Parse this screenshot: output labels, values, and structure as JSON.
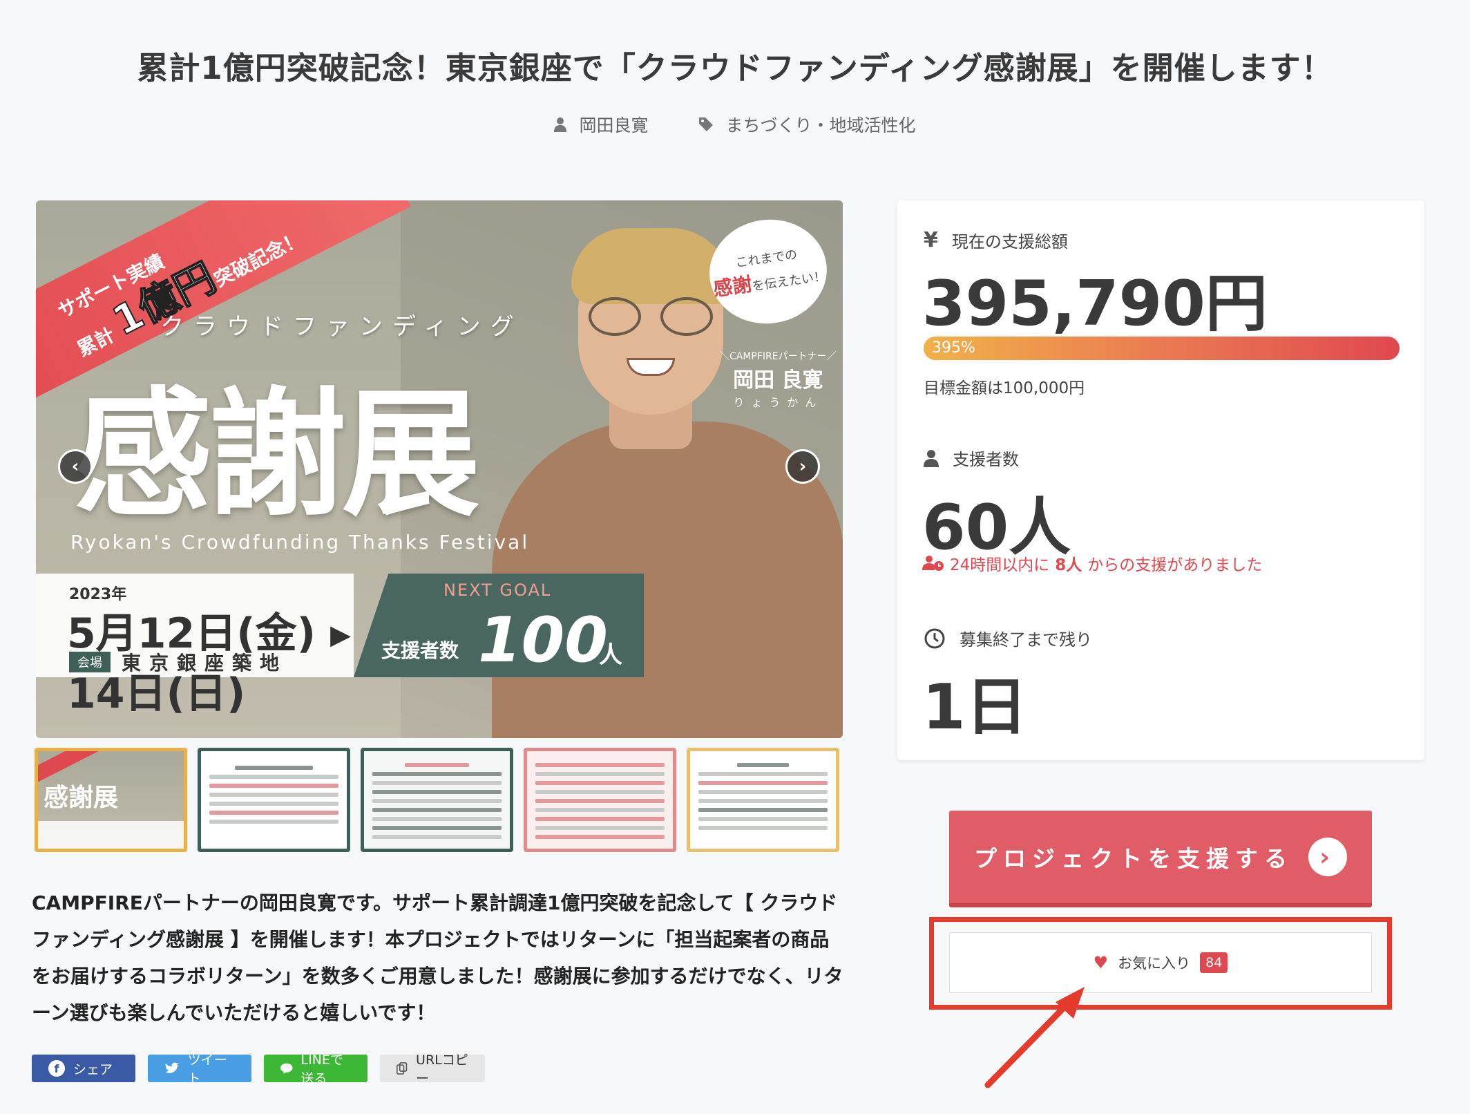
{
  "page": {
    "title": "累計1億円突破記念！東京銀座で「クラウドファンディング感謝展」を開催します！",
    "author": "岡田良寛",
    "category": "まちづくり・地域活性化"
  },
  "hero": {
    "ribbon_line1": "サポート実績",
    "ribbon_prefix": "累計",
    "ribbon_big": "1億円",
    "ribbon_line2": "突破記念！",
    "subtitle_jp": "クラウドファンディング",
    "main_jp": "感謝展",
    "main_en": "Ryokan's Crowdfunding Thanks Festival",
    "bubble_small": "これまでの",
    "bubble_accent": "感謝",
    "bubble_rest": "を伝えたい！",
    "role": "＼CAMPFIREパートナー／",
    "name": "岡田 良寛",
    "name_kana": "りょうかん",
    "year": "2023年",
    "dates": "5月12日(金) ▸ 14日(日)",
    "venue_label": "会場",
    "venue": "東京銀座築地",
    "next_goal": "NEXT GOAL",
    "goal_label": "支援者数",
    "goal_number": "100",
    "goal_unit": "人",
    "prev_glyph": "‹",
    "next_glyph": "›"
  },
  "thumbs": {
    "t1_text": "感謝展"
  },
  "description": "CAMPFIREパートナーの岡田良寛です。サポート累計調達1億円突破を記念して【 クラウドファンディング感謝展 】を開催します！本プロジェクトではリターンに「担当起案者の商品をお届けするコラボリターン」を数多くご用意しました！感謝展に参加するだけでなく、リターン選びも楽しんでいただけると嬉しいです！",
  "share": {
    "facebook": "シェア",
    "twitter": "ツイート",
    "line": "LINEで送る",
    "copy": "URLコピー"
  },
  "stats": {
    "amount_label": "現在の支援総額",
    "amount": "395,790円",
    "percent": "395%",
    "progress": 1.0,
    "goal_text": "目標金額は100,000円",
    "backers_label": "支援者数",
    "backers": "60人",
    "recent_prefix": "24時間以内に",
    "recent_count": "8人",
    "recent_suffix": "からの支援がありました",
    "remaining_label": "募集終了まで残り",
    "remaining": "1日"
  },
  "actions": {
    "support": "プロジェクトを支援する",
    "favorite": "お気に入り",
    "favorite_count": "84"
  },
  "colors": {
    "accent": "#e05c66",
    "highlight": "#e43b2c",
    "progress_start": "#f1b14a",
    "progress_end": "#e0484f"
  }
}
